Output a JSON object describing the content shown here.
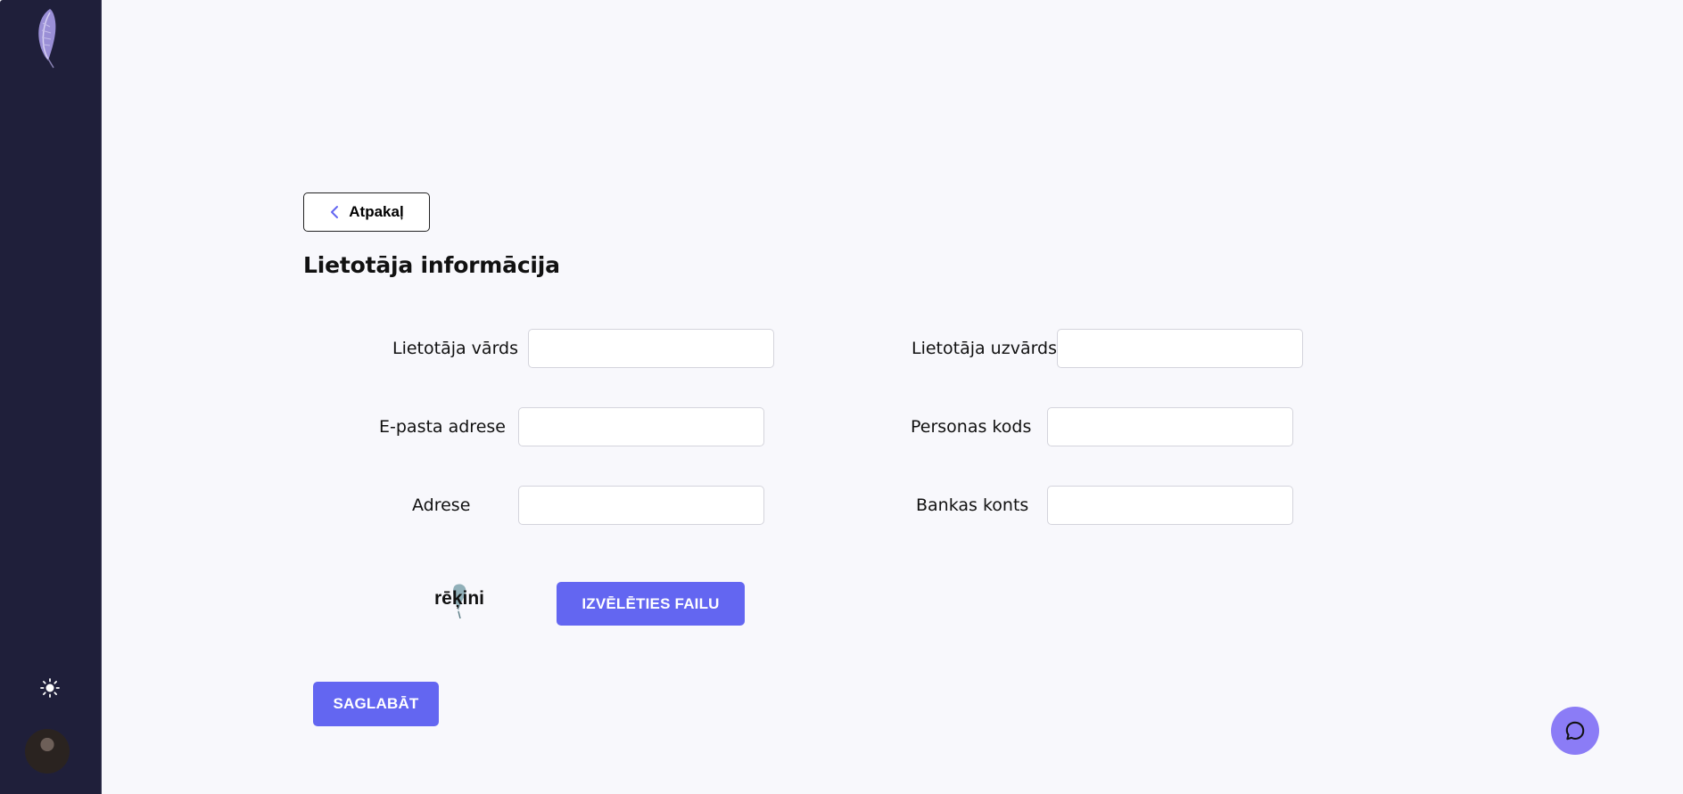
{
  "back_label": "Atpakaļ",
  "page_title": "Lietotāja informācija",
  "form": {
    "first_name": {
      "label": "Lietotāja vārds",
      "value": ""
    },
    "last_name": {
      "label": "Lietotāja uzvārds",
      "value": ""
    },
    "email": {
      "label": "E-pasta adrese",
      "value": ""
    },
    "personal_code": {
      "label": "Personas kods",
      "value": ""
    },
    "address": {
      "label": "Adrese",
      "value": ""
    },
    "bank_account": {
      "label": "Bankas konts",
      "value": ""
    }
  },
  "brand_logo_text": "rēķini",
  "choose_file_label": "IZVĒLĒTIES FAILU",
  "save_label": "SAGLABĀT",
  "icons": {
    "sidebar_logo": "feather-icon",
    "theme": "sun-icon",
    "back": "chevron-left-icon",
    "chat": "chat-bubble-icon"
  },
  "colors": {
    "sidebar_bg": "#1f1f3a",
    "page_bg": "#f8f8fc",
    "primary": "#6366f1",
    "chat": "#8b7cf6"
  }
}
